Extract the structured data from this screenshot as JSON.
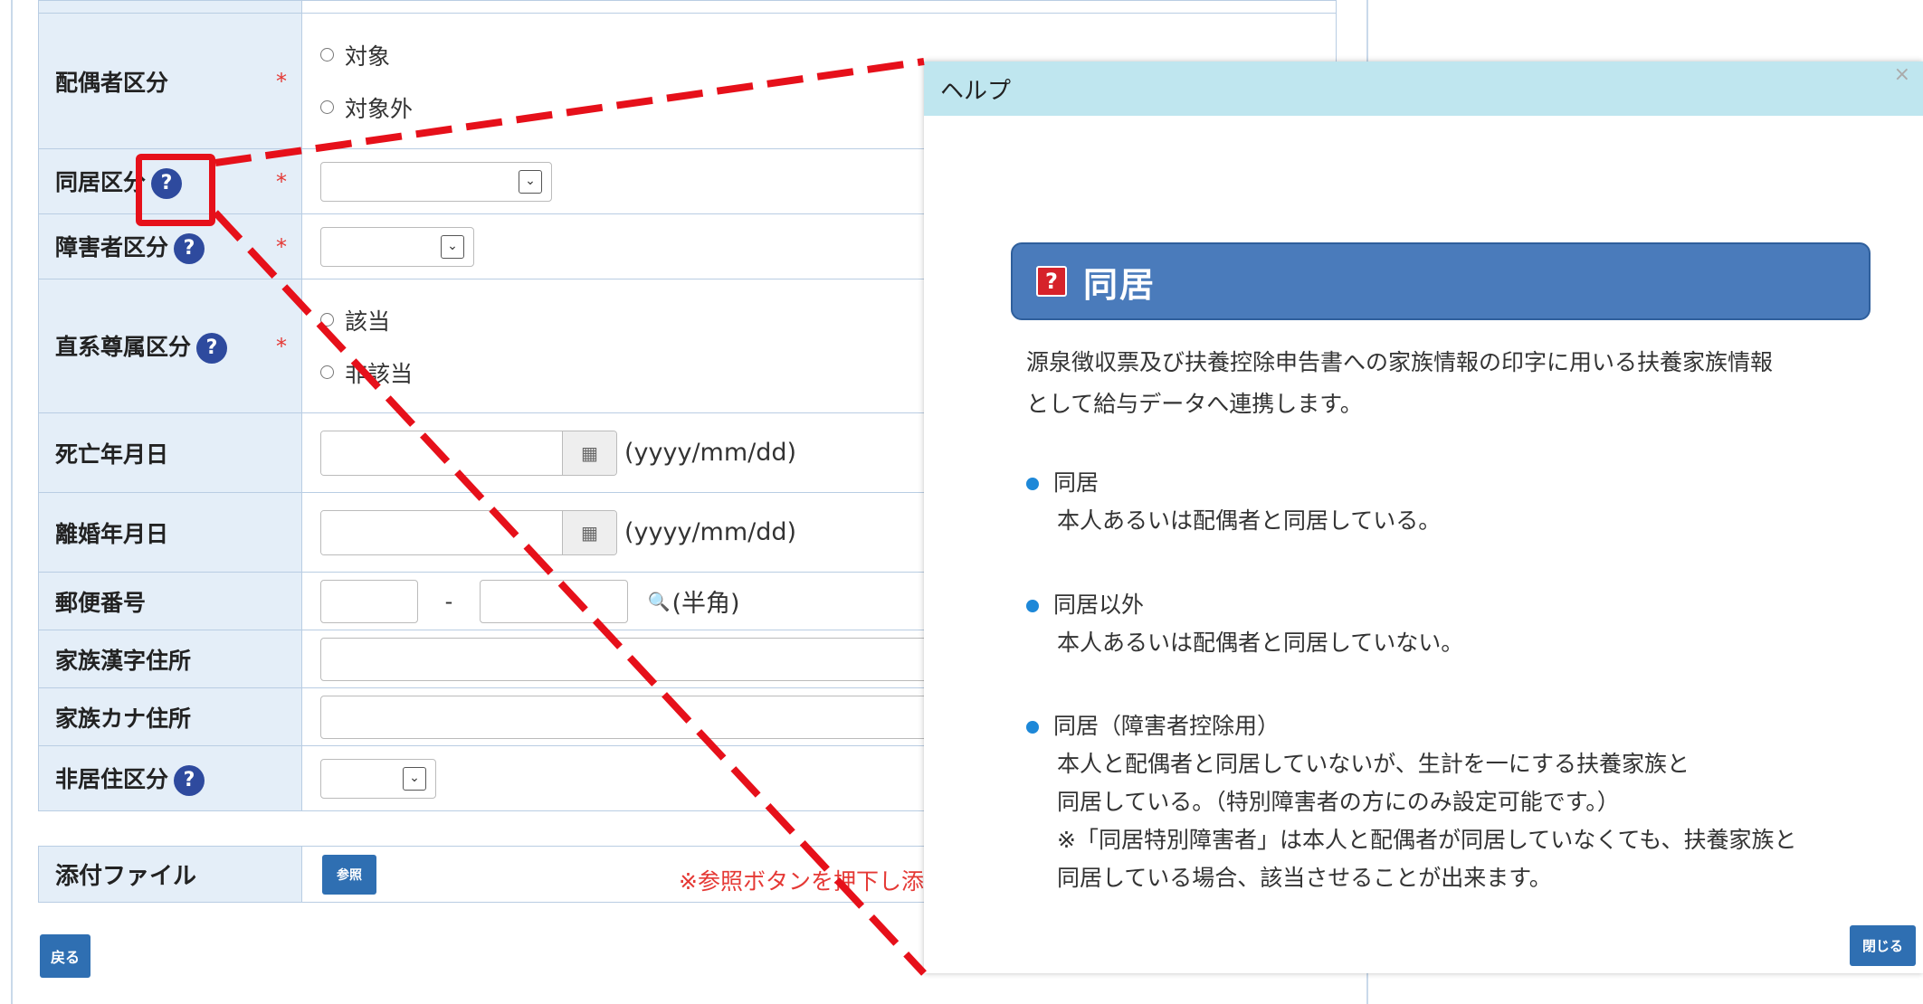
{
  "form": {
    "rows": {
      "spouse": {
        "label": "配偶者区分",
        "options": [
          "対象",
          "対象外"
        ]
      },
      "cohabit": {
        "label": "同居区分"
      },
      "disability": {
        "label": "障害者区分"
      },
      "lineal": {
        "label": "直系尊属区分",
        "options": [
          "該当",
          "非該当"
        ]
      },
      "death_date": {
        "label": "死亡年月日",
        "format": "(yyyy/mm/dd)"
      },
      "divorce_date": {
        "label": "離婚年月日",
        "format": "(yyyy/mm/dd)"
      },
      "postal": {
        "label": "郵便番号",
        "dash": "-",
        "note": "(半角)"
      },
      "kanji_address": {
        "label": "家族漢字住所"
      },
      "kana_address": {
        "label": "家族カナ住所"
      },
      "non_resident": {
        "label": "非居住区分"
      }
    },
    "required_mark": "*",
    "help_mark": "?",
    "attachment": {
      "label": "添付ファイル",
      "browse_label": "参照",
      "note": "※参照ボタンを押下し添"
    },
    "back_label": "戻る"
  },
  "help_dialog": {
    "header": "ヘルプ",
    "close_x": "×",
    "title_icon": "?",
    "title": "同居",
    "description_lines": [
      "源泉徴収票及び扶養控除申告書への家族情報の印字に用いる扶養家族情報",
      "として給与データへ連携します。"
    ],
    "items": [
      {
        "term": "同居",
        "lines": [
          "本人あるいは配偶者と同居している。"
        ]
      },
      {
        "term": "同居以外",
        "lines": [
          "本人あるいは配偶者と同居していない。"
        ]
      },
      {
        "term": "同居（障害者控除用）",
        "lines": [
          "本人と配偶者と同居していないが、生計を一にする扶養家族と",
          "同居している。（特別障害者の方にのみ設定可能です。）",
          "※「同居特別障害者」は本人と配偶者が同居していなくても、扶養家族と",
          "同居している場合、該当させることが出来ます。"
        ]
      }
    ],
    "close_button": "閉じる"
  },
  "colors": {
    "label_bg": "#e4eef8",
    "required": "#e53935",
    "help_icon": "#2e4a9e",
    "dialog_header": "#bfe6ef",
    "help_title_bg": "#4a7bbb",
    "bullet": "#1e88d8",
    "button": "#2f6fb2",
    "annotation": "#e6101a"
  },
  "icons": {
    "help": "question-circle-icon",
    "calendar": "calendar-icon",
    "search": "magnifier-icon",
    "select": "chevron-down-icon"
  }
}
